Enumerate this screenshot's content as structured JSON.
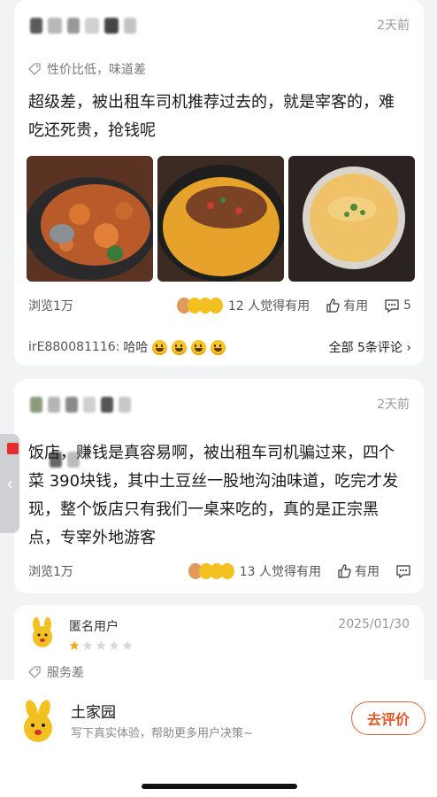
{
  "colors": {
    "background": "#f2f3f5",
    "accent": "#e0582a"
  },
  "reviews": [
    {
      "time": "2天前",
      "tags": "性价比低，味道差",
      "text": "超级差，被出租车司机推荐过去的，就是宰客的，难吃还死贵，抢钱呢",
      "views": "浏览1万",
      "helpful": "12 人觉得有用",
      "useful_label": "有用",
      "comment_count": "5",
      "comment": {
        "user": "irE880081116:",
        "text": "哈哈",
        "emoji_count": 4,
        "all_label": "全部 5条评论"
      }
    },
    {
      "time": "2天前",
      "text": "饭店，赚钱是真容易啊，被出租车司机骗过来，四个菜 390块钱，其中土豆丝一股地沟油味道，吃完才发现，整个饭店只有我们一桌来吃的，真的是正宗黑点，专宰外地游客",
      "views": "浏览1万",
      "helpful": "13 人觉得有用",
      "useful_label": "有用"
    },
    {
      "user": "匿名用户",
      "date": "2025/01/30",
      "rating": 1,
      "rating_max": 5,
      "tags": "服务差"
    }
  ],
  "bottom_bar": {
    "shop_name": "土家园",
    "prompt": "写下真实体验，帮助更多用户决策~",
    "rate_button": "去评价"
  },
  "icons": {
    "tag": "price-tag-icon",
    "thumb": "thumbs-up-icon",
    "comment": "comment-bubble-icon",
    "chevron": "chevron-right-icon",
    "side": "chevron-left-icon"
  }
}
